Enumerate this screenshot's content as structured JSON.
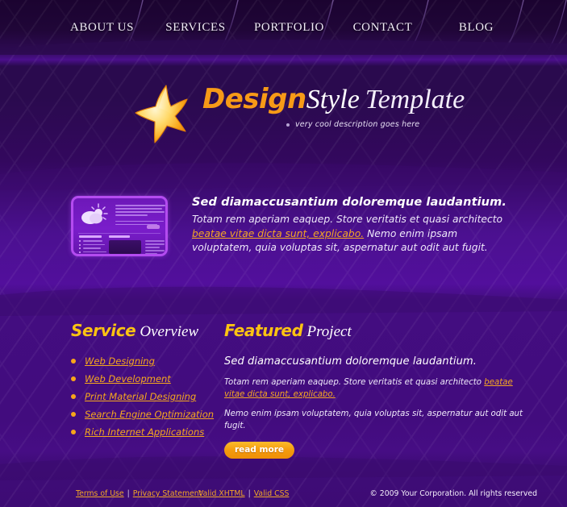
{
  "theme": {
    "bg_dark": "#1b0330",
    "bg_purple": "#4b1090",
    "accent_orange": "#f5a623",
    "accent_gold": "#fcc312",
    "text_light": "#efe8fa"
  },
  "nav": {
    "items": [
      {
        "label": "ABOUT US",
        "name": "nav-item-about-us"
      },
      {
        "label": "SERVICES",
        "name": "nav-item-services"
      },
      {
        "label": "PORTFOLIO",
        "name": "nav-item-portfolio"
      },
      {
        "label": "CONTACT",
        "name": "nav-item-contact"
      },
      {
        "label": "BLOG",
        "name": "nav-item-blog"
      }
    ]
  },
  "logo": {
    "icon": "star-icon",
    "part1": "Design",
    "part2": "Style",
    "part3": "Template",
    "tagline": "very cool description goes here"
  },
  "intro": {
    "thumbnail_icon": "weather-cloud-sun-icon",
    "heading": "Sed diamaccusantium doloremque laudantium.",
    "body_before": "Totam rem aperiam eaquep. Store veritatis et quasi architecto ",
    "link": "beatae vitae dicta sunt, explicabo.",
    "body_after": " Nemo enim ipsam voluptatem, quia voluptas sit, aspernatur aut odit aut fugit."
  },
  "service_section": {
    "heading_strong": "Service",
    "heading_light": "Overview",
    "items": [
      {
        "label": "Web Designing"
      },
      {
        "label": "Web Development"
      },
      {
        "label": "Print Material Designing"
      },
      {
        "label": "Search Engine Optimization"
      },
      {
        "label": "Rich Internet Applications"
      }
    ]
  },
  "featured_section": {
    "heading_strong": "Featured",
    "heading_light": "Project",
    "lead": "Sed diamaccusantium doloremque laudantium.",
    "paragraph_before": "Totam rem aperiam eaquep. Store veritatis et quasi architecto ",
    "paragraph_link": "beatae vitae dicta sunt, explicabo.",
    "paragraph_second": "Nemo enim ipsam voluptatem, quia voluptas sit, aspernatur aut odit aut fugit.",
    "button_label": "read more"
  },
  "footer": {
    "terms_label": "Terms of Use",
    "privacy_label": "Privacy Statement",
    "xhtml_label": "Valid XHTML",
    "css_label": "Valid CSS",
    "separator": "|",
    "copyright": "© 2009 Your Corporation. All rights reserved"
  }
}
